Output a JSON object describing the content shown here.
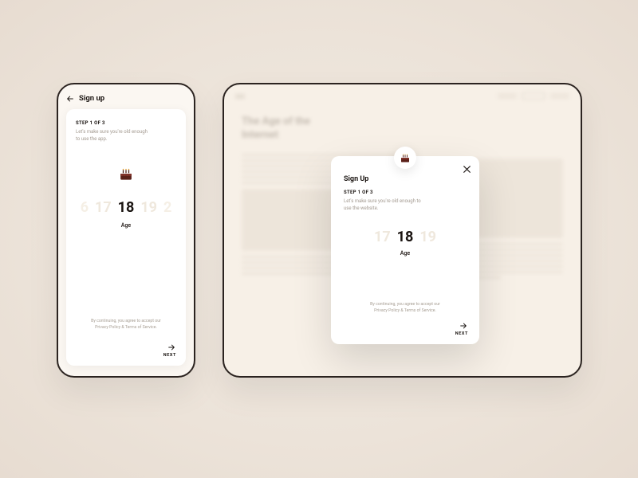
{
  "phone": {
    "title": "Sign up",
    "step": "STEP 1 OF 3",
    "sub1": "Let's make sure you're old enough",
    "sub2": "to use the app.",
    "ages": {
      "e1": "6",
      "n1": "17",
      "sel": "18",
      "n2": "19",
      "e2": "2"
    },
    "age_label": "Age",
    "disclaimer1": "By continuing, you agree to accept our",
    "disclaimer2": "Privacy Policy & Terms of Service.",
    "next": "NEXT"
  },
  "desktop": {
    "hero1": "The Age of the",
    "hero2": "Internet"
  },
  "modal": {
    "title": "Sign Up",
    "step": "STEP 1 OF 3",
    "sub1": "Let's make sure you're old enough to",
    "sub2": "use the website.",
    "ages": {
      "n1": "17",
      "sel": "18",
      "n2": "19"
    },
    "age_label": "Age",
    "disclaimer1": "By continuing, you agree to accept our",
    "disclaimer2": "Privacy Policy & Terms of Service.",
    "next": "NEXT"
  },
  "icons": {
    "cake": "cake-icon",
    "arrow_right": "arrow-right-icon",
    "arrow_left": "arrow-left-icon",
    "close": "close-icon"
  }
}
